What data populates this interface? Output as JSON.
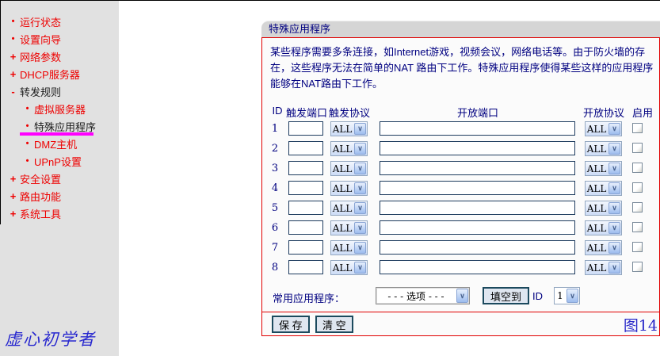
{
  "sidebar": {
    "items": [
      {
        "label": "运行状态",
        "type": "leaf"
      },
      {
        "label": "设置向导",
        "type": "leaf"
      },
      {
        "label": "网络参数",
        "type": "expand"
      },
      {
        "label": "DHCP服务器",
        "type": "expand"
      },
      {
        "label": "转发规则",
        "type": "collapse",
        "active": true
      },
      {
        "label": "虚拟服务器",
        "type": "sub"
      },
      {
        "label": "特殊应用程序",
        "type": "sub",
        "selected": true
      },
      {
        "label": "DMZ主机",
        "type": "sub"
      },
      {
        "label": "UPnP设置",
        "type": "sub"
      },
      {
        "label": "安全设置",
        "type": "expand"
      },
      {
        "label": "路由功能",
        "type": "expand"
      },
      {
        "label": "系统工具",
        "type": "expand"
      }
    ],
    "watermark": "虚心初学者"
  },
  "main": {
    "title": "特殊应用程序",
    "description": "某些程序需要多条连接，如Internet游戏，视频会议，网络电话等。由于防火墙的存在，这些程序无法在简单的NAT 路由下工作。特殊应用程序使得某些这样的应用程序能够在NAT路由下工作。",
    "table": {
      "headers": [
        "ID",
        "触发端口",
        "触发协议",
        "开放端口",
        "开放协议",
        "启用"
      ],
      "rows": [
        {
          "id": "1",
          "trigger_port": "",
          "trigger_protocol": "ALL",
          "open_port": "",
          "open_protocol": "ALL",
          "enabled": false
        },
        {
          "id": "2",
          "trigger_port": "",
          "trigger_protocol": "ALL",
          "open_port": "",
          "open_protocol": "ALL",
          "enabled": false
        },
        {
          "id": "3",
          "trigger_port": "",
          "trigger_protocol": "ALL",
          "open_port": "",
          "open_protocol": "ALL",
          "enabled": false
        },
        {
          "id": "4",
          "trigger_port": "",
          "trigger_protocol": "ALL",
          "open_port": "",
          "open_protocol": "ALL",
          "enabled": false
        },
        {
          "id": "5",
          "trigger_port": "",
          "trigger_protocol": "ALL",
          "open_port": "",
          "open_protocol": "ALL",
          "enabled": false
        },
        {
          "id": "6",
          "trigger_port": "",
          "trigger_protocol": "ALL",
          "open_port": "",
          "open_protocol": "ALL",
          "enabled": false
        },
        {
          "id": "7",
          "trigger_port": "",
          "trigger_protocol": "ALL",
          "open_port": "",
          "open_protocol": "ALL",
          "enabled": false
        },
        {
          "id": "8",
          "trigger_port": "",
          "trigger_protocol": "ALL",
          "open_port": "",
          "open_protocol": "ALL",
          "enabled": false
        }
      ]
    },
    "common_apps": {
      "label": "常用应用程序：",
      "selected_option": "- - - 选项 - - -",
      "fill_button_label": "填空到",
      "id_label": "ID",
      "id_selected": "1"
    },
    "footer": {
      "save_label": "保 存",
      "clear_label": "清 空",
      "figure_label": "图14"
    }
  },
  "colors": {
    "accent_red": "#e00000",
    "menu_red": "#ee0000",
    "navy_text": "#000080",
    "selected_underline": "#ff00ff",
    "sidebar_bg": "#e1e1e1",
    "titlebar_bg": "#d5d5d5"
  }
}
